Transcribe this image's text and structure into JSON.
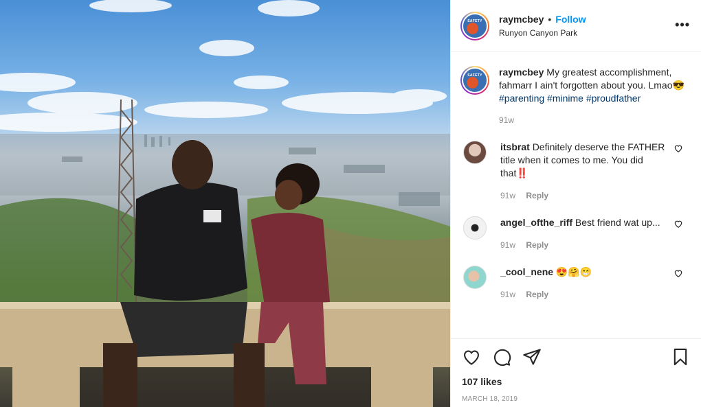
{
  "post": {
    "username": "raymcbey",
    "separator": "•",
    "follow_label": "Follow",
    "location": "Runyon Canyon Park",
    "more_icon": "more-options-icon",
    "avatar_tag": "SAFETY",
    "caption": {
      "username": "raymcbey",
      "text": "My greatest accomplishment, fahmarr I ain't forgotten about you. Lmao😎",
      "hashtags": "#parenting #minime #proudfather",
      "timestamp": "91w"
    },
    "comments": [
      {
        "username": "itsbrat",
        "text": "Definitely deserve the FATHER title when it comes to me. You did that‼️",
        "time": "91w",
        "reply": "Reply"
      },
      {
        "username": "angel_ofthe_riff",
        "text": "Best friend wat up...",
        "time": "91w",
        "reply": "Reply"
      },
      {
        "username": "_cool_nene",
        "text": "😍🤗😁",
        "time": "91w",
        "reply": "Reply"
      }
    ],
    "likes": "107 likes",
    "date": "MARCH 18, 2019"
  },
  "icons": {
    "like": "heart-icon",
    "comment": "comment-icon",
    "share": "share-icon",
    "save": "bookmark-icon"
  },
  "colors": {
    "link_blue": "#0095f6",
    "hashtag": "#00376b",
    "muted": "#8e8e8e"
  }
}
